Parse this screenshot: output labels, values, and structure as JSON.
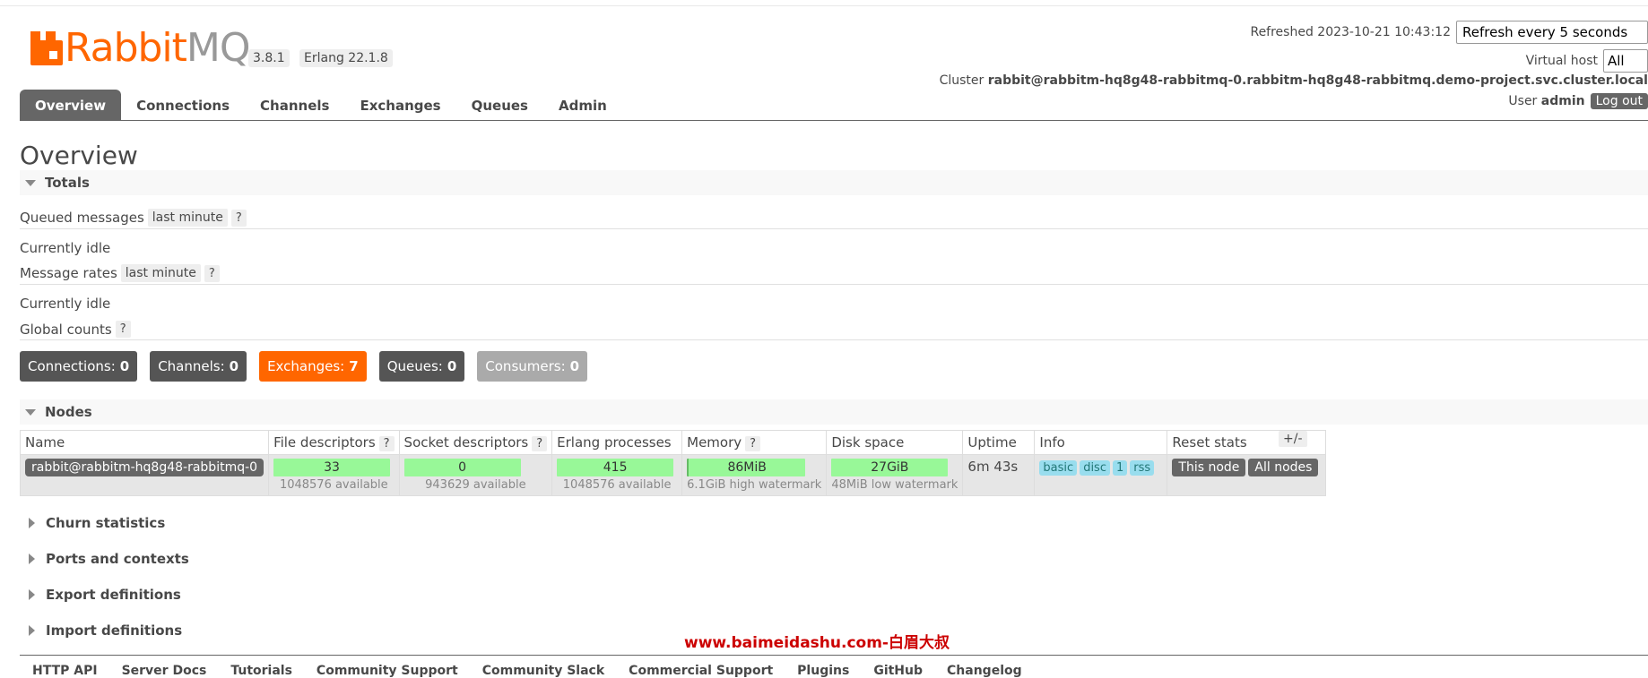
{
  "app": {
    "brand_rabbit": "Rabbit",
    "brand_mq": "MQ",
    "version": "3.8.1",
    "erlang": "Erlang 22.1.8"
  },
  "header": {
    "refreshed_label": "Refreshed",
    "refreshed_time": "2023-10-21 10:43:12",
    "refresh_select": "Refresh every 5 seconds",
    "vhost_label": "Virtual host",
    "vhost_select": "All",
    "cluster_label": "Cluster",
    "cluster_name": "rabbit@rabbitm-hq8g48-rabbitmq-0.rabbitm-hq8g48-rabbitmq.demo-project.svc.cluster.local",
    "user_label": "User",
    "user_name": "admin",
    "logout": "Log out"
  },
  "tabs": [
    "Overview",
    "Connections",
    "Channels",
    "Exchanges",
    "Queues",
    "Admin"
  ],
  "page_title": "Overview",
  "totals": {
    "title": "Totals",
    "queued_label": "Queued messages",
    "queued_range": "last minute",
    "qmark": "?",
    "idle1": "Currently idle",
    "rates_label": "Message rates",
    "rates_range": "last minute",
    "idle2": "Currently idle",
    "global_label": "Global counts"
  },
  "counts": [
    {
      "label": "Connections:",
      "value": "0"
    },
    {
      "label": "Channels:",
      "value": "0"
    },
    {
      "label": "Exchanges:",
      "value": "7"
    },
    {
      "label": "Queues:",
      "value": "0"
    },
    {
      "label": "Consumers:",
      "value": "0"
    }
  ],
  "nodes": {
    "title": "Nodes",
    "headers": [
      "Name",
      "File descriptors",
      "Socket descriptors",
      "Erlang processes",
      "Memory",
      "Disk space",
      "Uptime",
      "Info",
      "Reset stats"
    ],
    "plusminus": "+/-",
    "row": {
      "name": "rabbit@rabbitm-hq8g48-rabbitmq-0",
      "fd": "33",
      "fd_avail": "1048576 available",
      "sd": "0",
      "sd_avail": "943629 available",
      "ep": "415",
      "ep_avail": "1048576 available",
      "mem": "86MiB",
      "mem_sub": "6.1GiB high watermark",
      "disk": "27GiB",
      "disk_sub": "48MiB low watermark",
      "uptime": "6m 43s",
      "info": [
        "basic",
        "disc",
        "1",
        "rss"
      ],
      "reset_this": "This node",
      "reset_all": "All nodes"
    }
  },
  "collapsed": [
    "Churn statistics",
    "Ports and contexts",
    "Export definitions",
    "Import definitions"
  ],
  "watermark": "www.baimeidashu.com-白眉大叔",
  "footer": [
    "HTTP API",
    "Server Docs",
    "Tutorials",
    "Community Support",
    "Community Slack",
    "Commercial Support",
    "Plugins",
    "GitHub",
    "Changelog"
  ]
}
